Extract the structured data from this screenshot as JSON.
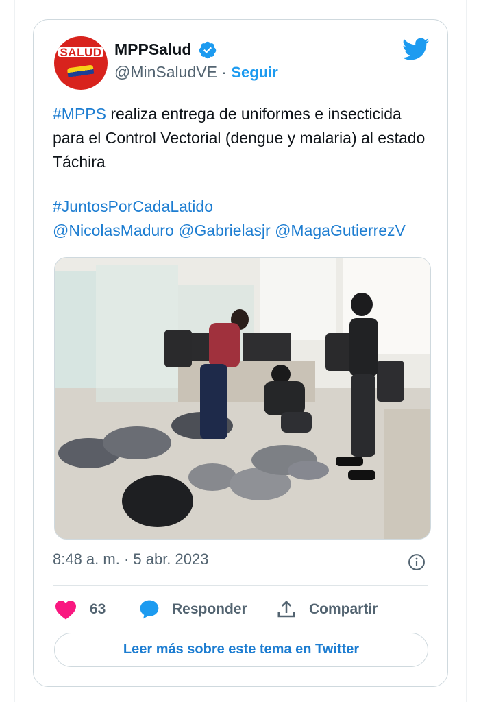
{
  "tweet": {
    "author": {
      "avatar_text": "SALUD",
      "display_name": "MPPSalud",
      "handle": "@MinSaludVE",
      "separator": " · ",
      "follow_label": "Seguir",
      "verified": true,
      "avatar_color": "#d8231d"
    },
    "text": {
      "hashtag": "#MPPS",
      "line1": " realiza entrega de uniformes  e insecticida para el Control Vectorial (dengue y malaria) al estado Táchira",
      "hashtag2": "#JuntosPorCadaLatido",
      "mentions": "@NicolasMaduro @Gabrielasjr @MagaGutierrezV"
    },
    "media": {
      "alt_icon": "photo-of-people-packing-uniform-bags"
    },
    "timestamp": "8:48 a. m. · 5 abr. 2023",
    "actions": {
      "likes_count": "63",
      "reply_label": "Responder",
      "share_label": "Compartir"
    },
    "read_more_label": "Leer más sobre este tema en Twitter"
  },
  "colors": {
    "accent": "#1d9bf0",
    "link": "#1d7dd1",
    "like": "#f91880",
    "muted": "#536471",
    "border": "#cfd9de"
  },
  "icons": [
    "twitter-bird-icon",
    "verified-badge-icon",
    "info-icon",
    "heart-icon",
    "reply-bubble-icon",
    "share-icon"
  ]
}
